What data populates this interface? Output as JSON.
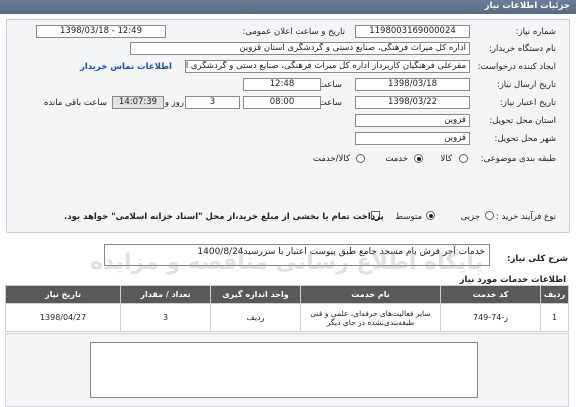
{
  "window_title": "جزئیات اطلاعات نیاز",
  "form": {
    "need_number_label": "شماره نیاز:",
    "need_number": "1198003169000024",
    "announce_label": "تاریخ و ساعت اعلان عمومی:",
    "announce_value": "1398/03/18 - 12:49",
    "buyer_label": "نام دستگاه خریدار:",
    "buyer_value": "اداره کل میراث فرهنگی، صنایع دستی و گردشگری استان قزوین",
    "creator_label": "ایجاد کننده درخواست:",
    "creator_value": "مفرعلی فرهنگیان کاربرداز اداره کل میراث فرهنگی، صنایع دستی و گردشگری ا",
    "contact_link": "اطلاعات تماس خریدار",
    "send_date_label": "تاریخ ارسال نیاز:",
    "send_date": "1398/03/18",
    "send_time_label": "ساعت",
    "send_time": "12:48",
    "valid_date_label": "تاریخ اعتبار نیاز:",
    "valid_date": "1398/03/22",
    "valid_time_label": "ساعت",
    "valid_time": "08:00",
    "days_value": "3",
    "days_label": "روز و",
    "remaining_time": "14:07:39",
    "remaining_label": "ساعت باقی مانده",
    "province_label": "استان محل تحویل:",
    "province_value": "قزوین",
    "city_label": "شهر محل تحویل:",
    "city_value": "قزوین",
    "category_label": "طبقه بندی موضوعی:",
    "category_options": [
      "کالا",
      "خدمت",
      "کالا/خدمت"
    ],
    "category_selected": "خدمت",
    "process_label": "نوع فرآیند خرید :",
    "process_options": [
      "جزیی",
      "متوسط"
    ],
    "process_selected": "متوسط",
    "payment_note": "پرداخت تمام یا بخشی از مبلغ خرید،از محل \"اسناد خزانه اسلامی\" خواهد بود."
  },
  "description": {
    "label": "شرح کلی نیاز:",
    "value": "خدمات آجر فرش بام مسجد جامع طبق پیوست اعتبار با سررسید1400/8/24"
  },
  "services": {
    "section_title": "اطلاعات خدمات مورد نیاز",
    "columns": [
      "ردیف",
      "کد خدمت",
      "نام خدمت",
      "واحد اندازه گیری",
      "تعداد / مقدار",
      "تاریخ نیاز"
    ],
    "rows": [
      {
        "row": "1",
        "code": "ز-74-749",
        "name": "سایر فعالیت‌های حرفه‌ای، علمی و فنی طبقه‌بندی‌نشده در جای دیگر",
        "unit": "ردیف",
        "qty": "3",
        "date": "1398/04/27"
      }
    ]
  },
  "watermark": "پایگاه اطلاع رسانی مناقصه و مزایده"
}
